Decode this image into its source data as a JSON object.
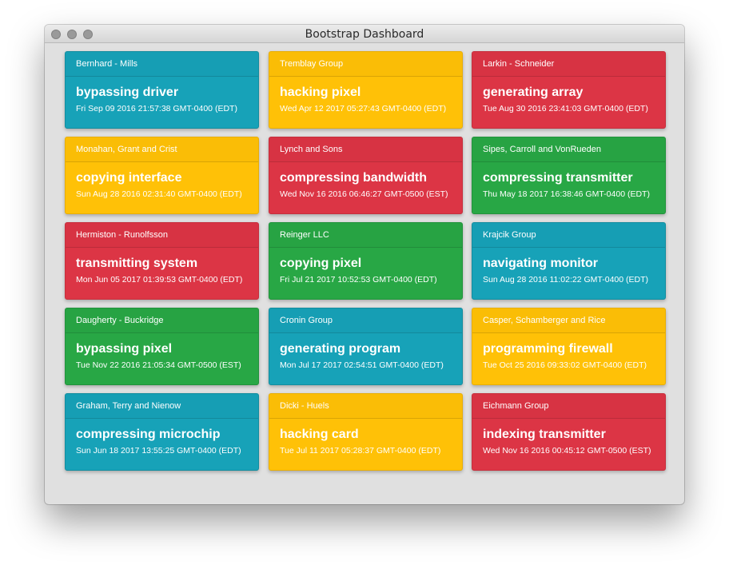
{
  "window": {
    "title": "Bootstrap Dashboard"
  },
  "colors": {
    "info": "#17a2b8",
    "warning": "#ffc107",
    "danger": "#dc3545",
    "success": "#28a745"
  },
  "cards": [
    {
      "company": "Bernhard - Mills",
      "action": "bypassing driver",
      "date": "Fri Sep 09 2016 21:57:38 GMT-0400 (EDT)",
      "variant": "info"
    },
    {
      "company": "Tremblay Group",
      "action": "hacking pixel",
      "date": "Wed Apr 12 2017 05:27:43 GMT-0400 (EDT)",
      "variant": "warning"
    },
    {
      "company": "Larkin - Schneider",
      "action": "generating array",
      "date": "Tue Aug 30 2016 23:41:03 GMT-0400 (EDT)",
      "variant": "danger"
    },
    {
      "company": "Monahan, Grant and Crist",
      "action": "copying interface",
      "date": "Sun Aug 28 2016 02:31:40 GMT-0400 (EDT)",
      "variant": "warning"
    },
    {
      "company": "Lynch and Sons",
      "action": "compressing bandwidth",
      "date": "Wed Nov 16 2016 06:46:27 GMT-0500 (EST)",
      "variant": "danger"
    },
    {
      "company": "Sipes, Carroll and VonRueden",
      "action": "compressing transmitter",
      "date": "Thu May 18 2017 16:38:46 GMT-0400 (EDT)",
      "variant": "success"
    },
    {
      "company": "Hermiston - Runolfsson",
      "action": "transmitting system",
      "date": "Mon Jun 05 2017 01:39:53 GMT-0400 (EDT)",
      "variant": "danger"
    },
    {
      "company": "Reinger LLC",
      "action": "copying pixel",
      "date": "Fri Jul 21 2017 10:52:53 GMT-0400 (EDT)",
      "variant": "success"
    },
    {
      "company": "Krajcik Group",
      "action": "navigating monitor",
      "date": "Sun Aug 28 2016 11:02:22 GMT-0400 (EDT)",
      "variant": "info"
    },
    {
      "company": "Daugherty - Buckridge",
      "action": "bypassing pixel",
      "date": "Tue Nov 22 2016 21:05:34 GMT-0500 (EST)",
      "variant": "success"
    },
    {
      "company": "Cronin Group",
      "action": "generating program",
      "date": "Mon Jul 17 2017 02:54:51 GMT-0400 (EDT)",
      "variant": "info"
    },
    {
      "company": "Casper, Schamberger and Rice",
      "action": "programming firewall",
      "date": "Tue Oct 25 2016 09:33:02 GMT-0400 (EDT)",
      "variant": "warning"
    },
    {
      "company": "Graham, Terry and Nienow",
      "action": "compressing microchip",
      "date": "Sun Jun 18 2017 13:55:25 GMT-0400 (EDT)",
      "variant": "info"
    },
    {
      "company": "Dicki - Huels",
      "action": "hacking card",
      "date": "Tue Jul 11 2017 05:28:37 GMT-0400 (EDT)",
      "variant": "warning"
    },
    {
      "company": "Eichmann Group",
      "action": "indexing transmitter",
      "date": "Wed Nov 16 2016 00:45:12 GMT-0500 (EST)",
      "variant": "danger"
    }
  ]
}
